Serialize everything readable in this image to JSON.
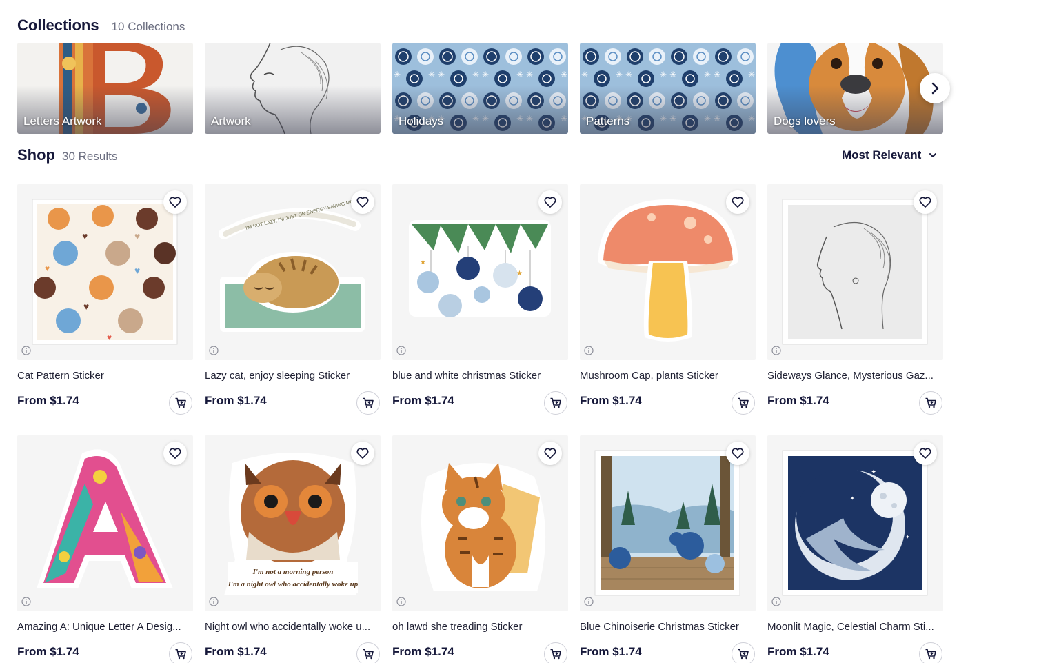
{
  "collections": {
    "title": "Collections",
    "count": "10 Collections",
    "items": [
      {
        "label": "Letters Artwork"
      },
      {
        "label": "Artwork"
      },
      {
        "label": "Holidays"
      },
      {
        "label": "Patterns"
      },
      {
        "label": "Dogs lovers"
      }
    ]
  },
  "shop": {
    "title": "Shop",
    "results": "30 Results",
    "sort_label": "Most Relevant"
  },
  "products": [
    {
      "name": "Cat Pattern Sticker",
      "price": "From $1.74"
    },
    {
      "name": "Lazy cat, enjoy sleeping Sticker",
      "price": "From $1.74",
      "art_text": "I'M NOT LAZY, I'M JUST ON ENERGY-SAVING MODE"
    },
    {
      "name": "blue and white christmas Sticker",
      "price": "From $1.74"
    },
    {
      "name": "Mushroom Cap, plants Sticker",
      "price": "From $1.74"
    },
    {
      "name": "Sideways Glance, Mysterious Gaz...",
      "price": "From $1.74"
    },
    {
      "name": "Amazing A: Unique Letter A Desig...",
      "price": "From $1.74"
    },
    {
      "name": "Night owl who accidentally woke u...",
      "price": "From $1.74",
      "art_line1": "I'm not a morning person",
      "art_line2": "I'm a night owl who accidentally woke up"
    },
    {
      "name": "oh lawd she treading Sticker",
      "price": "From $1.74"
    },
    {
      "name": "Blue Chinoiserie Christmas Sticker",
      "price": "From $1.74"
    },
    {
      "name": "Moonlit Magic, Celestial Charm Sti...",
      "price": "From $1.74"
    }
  ],
  "icons": {
    "heart": "heart-icon",
    "cart": "add-to-cart-icon",
    "info": "info-icon",
    "chevron": "chevron-down-icon",
    "next": "chevron-right-icon"
  }
}
